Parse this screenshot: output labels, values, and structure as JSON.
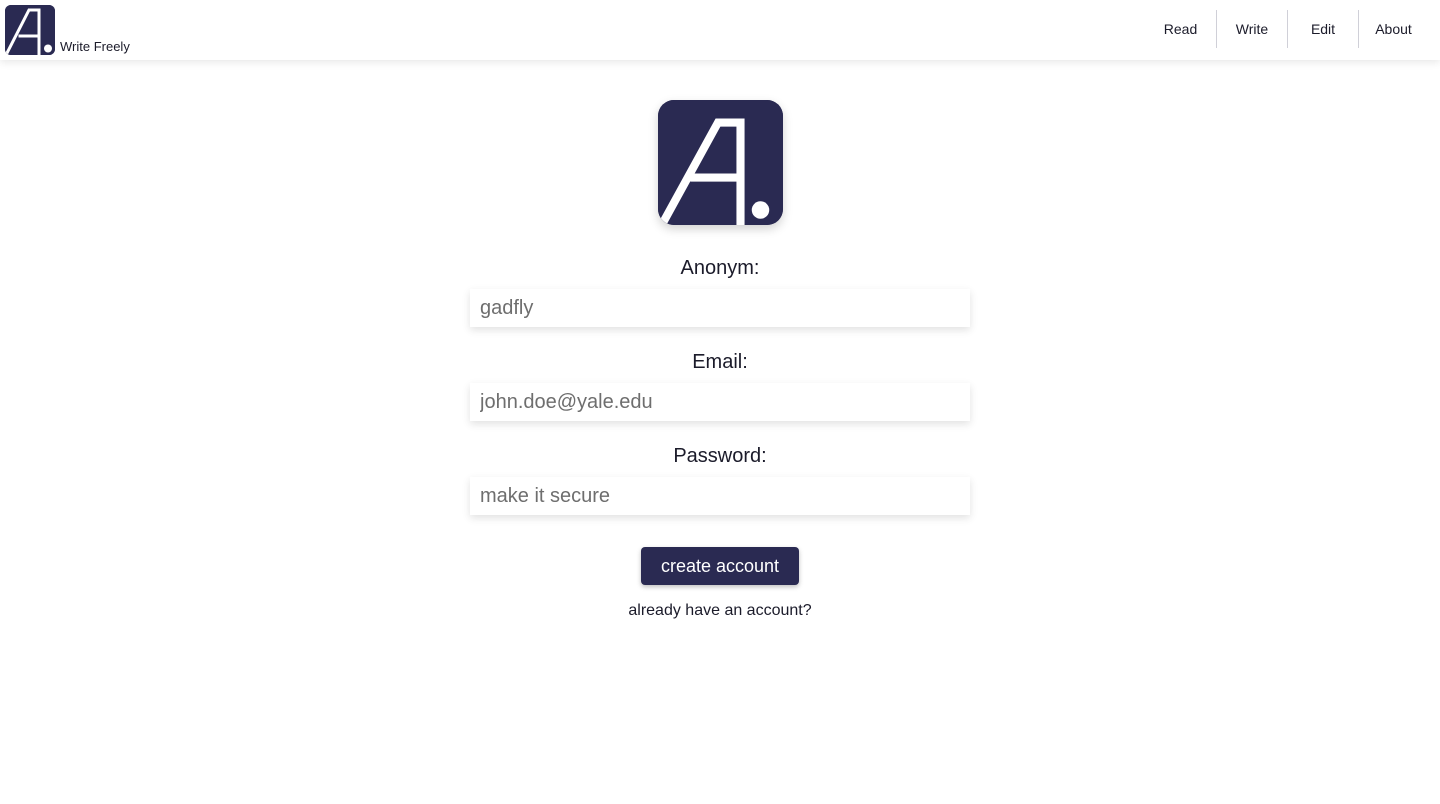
{
  "header": {
    "brand_name": "Write Freely",
    "logo_icon": "letter-a-dot-logo",
    "nav": [
      {
        "label": "Read"
      },
      {
        "label": "Write"
      },
      {
        "label": "Edit"
      },
      {
        "label": "About"
      }
    ]
  },
  "form": {
    "logo_icon": "letter-a-dot-logo",
    "fields": {
      "anonym": {
        "label": "Anonym:",
        "placeholder": "gadfly"
      },
      "email": {
        "label": "Email:",
        "placeholder": "john.doe@yale.edu"
      },
      "password": {
        "label": "Password:",
        "placeholder": "make it secure"
      }
    },
    "submit_label": "create account",
    "login_link": "already have an account?"
  },
  "colors": {
    "brand": "#2a2a52",
    "background": "#ffffff",
    "text": "#1b1b2a",
    "placeholder": "#6e6e6e"
  }
}
